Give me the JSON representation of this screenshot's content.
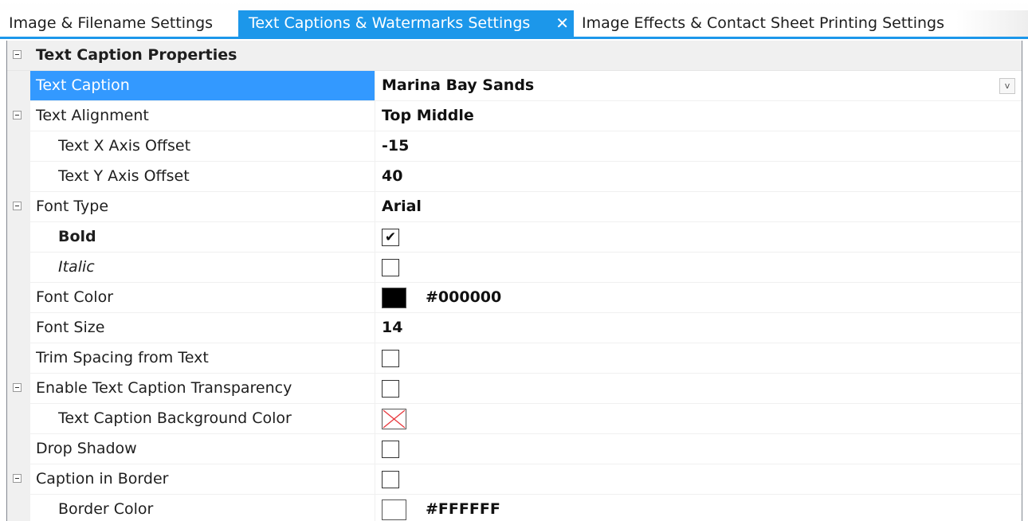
{
  "tabs": [
    {
      "label": "Image & Filename Settings",
      "active": false
    },
    {
      "label": "Text Captions & Watermarks Settings",
      "active": true,
      "close_glyph": "✕"
    },
    {
      "label": "Image Effects & Contact Sheet Printing Settings",
      "active": false
    }
  ],
  "colors": {
    "accent": "#1c97ea",
    "selection": "#3399ff",
    "font_color_swatch": "#000000",
    "border_color_swatch": "#FFFFFF",
    "no_color_cross": "#e8383d"
  },
  "property_grid": {
    "category": "Text Caption Properties",
    "rows": {
      "text_caption": {
        "label": "Text Caption",
        "value": "Marina Bay Sands",
        "dropdown_glyph": "v"
      },
      "text_alignment": {
        "label": "Text Alignment",
        "value": "Top Middle"
      },
      "text_x_offset": {
        "label": "Text X Axis Offset",
        "value": "-15"
      },
      "text_y_offset": {
        "label": "Text Y Axis Offset",
        "value": "40"
      },
      "font_type": {
        "label": "Font Type",
        "value": "Arial"
      },
      "bold": {
        "label": "Bold",
        "checked": true,
        "check_glyph": "✔"
      },
      "italic": {
        "label": "Italic",
        "checked": false
      },
      "font_color": {
        "label": "Font Color",
        "value": "#000000"
      },
      "font_size": {
        "label": "Font Size",
        "value": "14"
      },
      "trim_spacing": {
        "label": "Trim Spacing from Text",
        "checked": false
      },
      "enable_transparency": {
        "label": "Enable Text Caption Transparency",
        "checked": false
      },
      "caption_bg_color": {
        "label": "Text Caption Background Color",
        "value_icon": "no-color-icon"
      },
      "drop_shadow": {
        "label": "Drop Shadow",
        "checked": false
      },
      "caption_in_border": {
        "label": "Caption in Border",
        "checked": false
      },
      "border_color": {
        "label": "Border Color",
        "value": "#FFFFFF"
      }
    }
  }
}
